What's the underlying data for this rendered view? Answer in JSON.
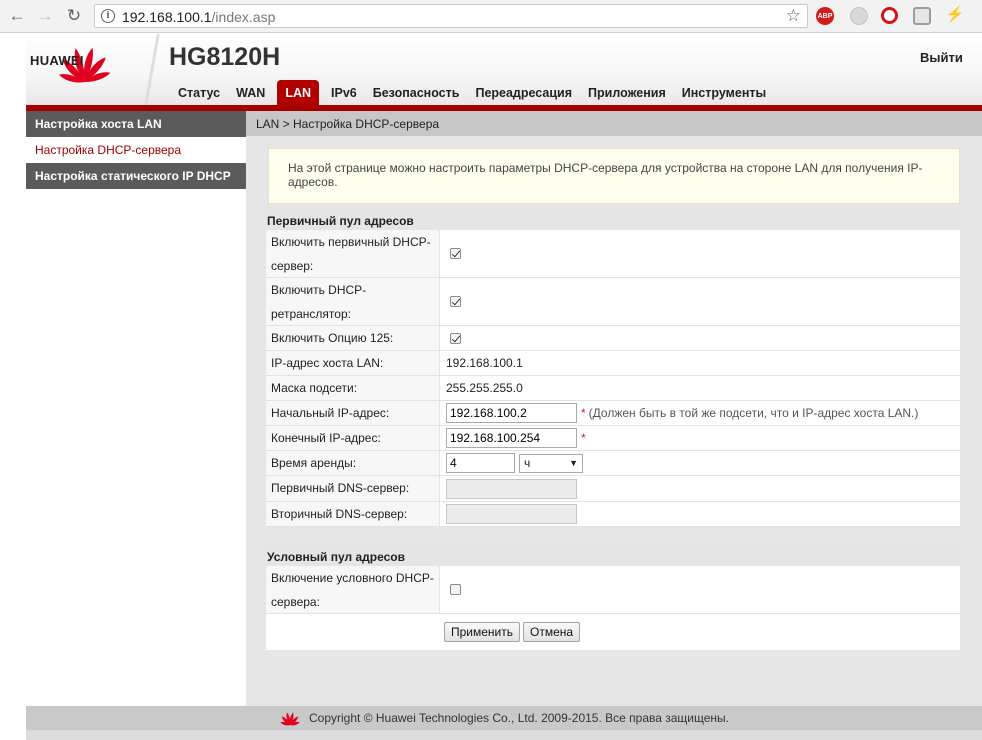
{
  "browser": {
    "url_host": "192.168.100.1",
    "url_path": "/index.asp",
    "abp_label": "ABP"
  },
  "header": {
    "logo_text": "HUAWEI",
    "device_title": "HG8120H",
    "logout": "Выйти",
    "nav": [
      "Статус",
      "WAN",
      "LAN",
      "IPv6",
      "Безопасность",
      "Переадресация",
      "Приложения",
      "Инструменты"
    ],
    "active_nav": "LAN"
  },
  "sidebar": {
    "items": [
      {
        "label": "Настройка хоста LAN"
      },
      {
        "label": "Настройка DHCP-сервера"
      },
      {
        "label": "Настройка статического IP DHCP"
      }
    ]
  },
  "breadcrumb": "LAN > Настройка DHCP-сервера",
  "info": "На этой странице можно настроить параметры DHCP-сервера для устройства на стороне LAN для получения IP-адресов.",
  "primary_pool": {
    "title": "Первичный пул адресов",
    "enable_dhcp_label_1": "Включить первичный DHCP-",
    "enable_dhcp_label_2": "сервер:",
    "enable_dhcp": true,
    "enable_relay_label_1": "Включить DHCP-",
    "enable_relay_label_2": "ретранслятор:",
    "enable_relay": true,
    "option125_label": "Включить Опцию 125:",
    "option125": true,
    "host_ip_label": "IP-адрес хоста LAN:",
    "host_ip": "192.168.100.1",
    "mask_label": "Маска подсети:",
    "mask": "255.255.255.0",
    "start_ip_label": "Начальный IP-адрес:",
    "start_ip": "192.168.100.2",
    "required_mark": "*",
    "start_ip_hint": "(Должен быть в той же подсети, что и IP-адрес хоста LAN.)",
    "end_ip_label": "Конечный IP-адрес:",
    "end_ip": "192.168.100.254",
    "lease_label": "Время аренды:",
    "lease_value": "4",
    "lease_unit": "ч",
    "dns1_label": "Первичный DNS-сервер:",
    "dns1": "",
    "dns2_label": "Вторичный DNS-сервер:",
    "dns2": ""
  },
  "conditional_pool": {
    "title": "Условный пул адресов",
    "enable_label_1": "Включение условного DHCP-",
    "enable_label_2": "сервера:",
    "enabled": false
  },
  "buttons": {
    "apply": "Применить",
    "cancel": "Отмена"
  },
  "footer": {
    "copyright": "Copyright © Huawei Technologies Co., Ltd. 2009-2015. Все права защищены."
  },
  "colors": {
    "brand_red": "#a40000",
    "sidebar_dark": "#5b5b5b",
    "info_bg": "#fffff0"
  }
}
